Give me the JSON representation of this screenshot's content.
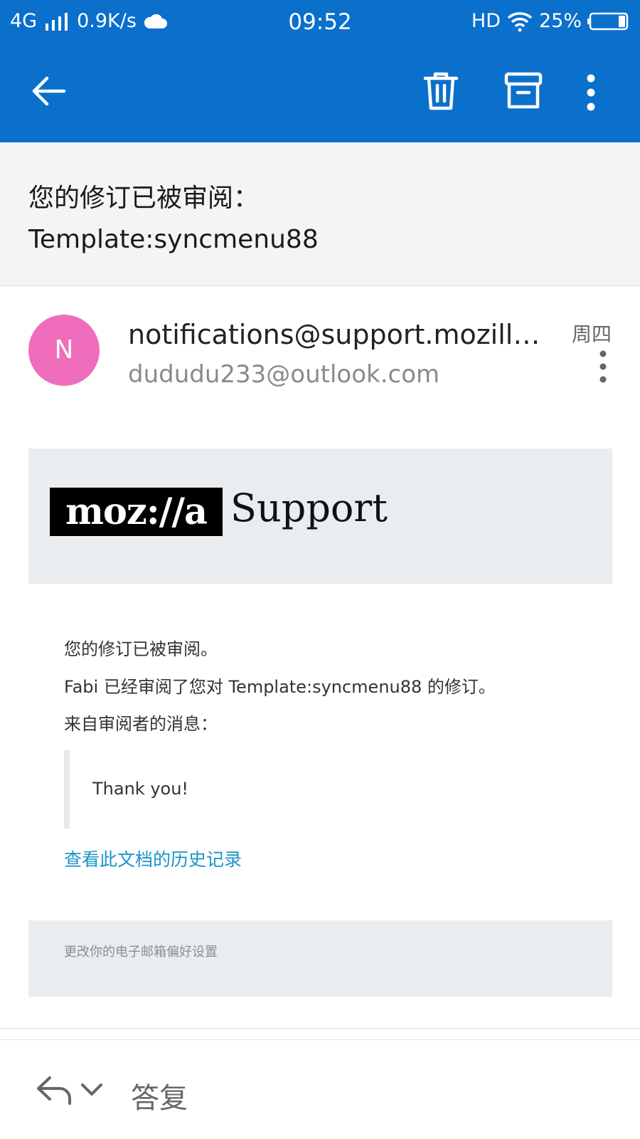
{
  "status_bar": {
    "network": "4G",
    "speed": "0.9K/s",
    "time": "09:52",
    "hd": "HD",
    "battery": "25%"
  },
  "toolbar": {
    "back_icon": "arrow-left-icon",
    "delete_icon": "trash-icon",
    "archive_icon": "archive-icon",
    "more_icon": "more-vertical-icon"
  },
  "email": {
    "subject_line1": "您的修订已被审阅：",
    "subject_line2": "Template:syncmenu88",
    "avatar_letter": "N",
    "from": "notifications@support.mozilla.org",
    "to": "dududu233@outlook.com",
    "date": "周四",
    "banner_logo": "moz://a",
    "banner_support": "Support",
    "body_line1": "您的修订已被审阅。",
    "body_line2": "Fabi 已经审阅了您对 Template:syncmenu88 的修订。",
    "body_line3": "来自审阅者的消息：",
    "quote": "Thank you!",
    "history_link": "查看此文档的历史记录",
    "footer_link": "更改你的电子邮箱偏好设置"
  },
  "reply_bar": {
    "label": "答复"
  },
  "colors": {
    "primary": "#0b6fcc",
    "avatar": "#ef6dbb",
    "link": "#1a93c9",
    "banner_bg": "#e9edf0"
  }
}
